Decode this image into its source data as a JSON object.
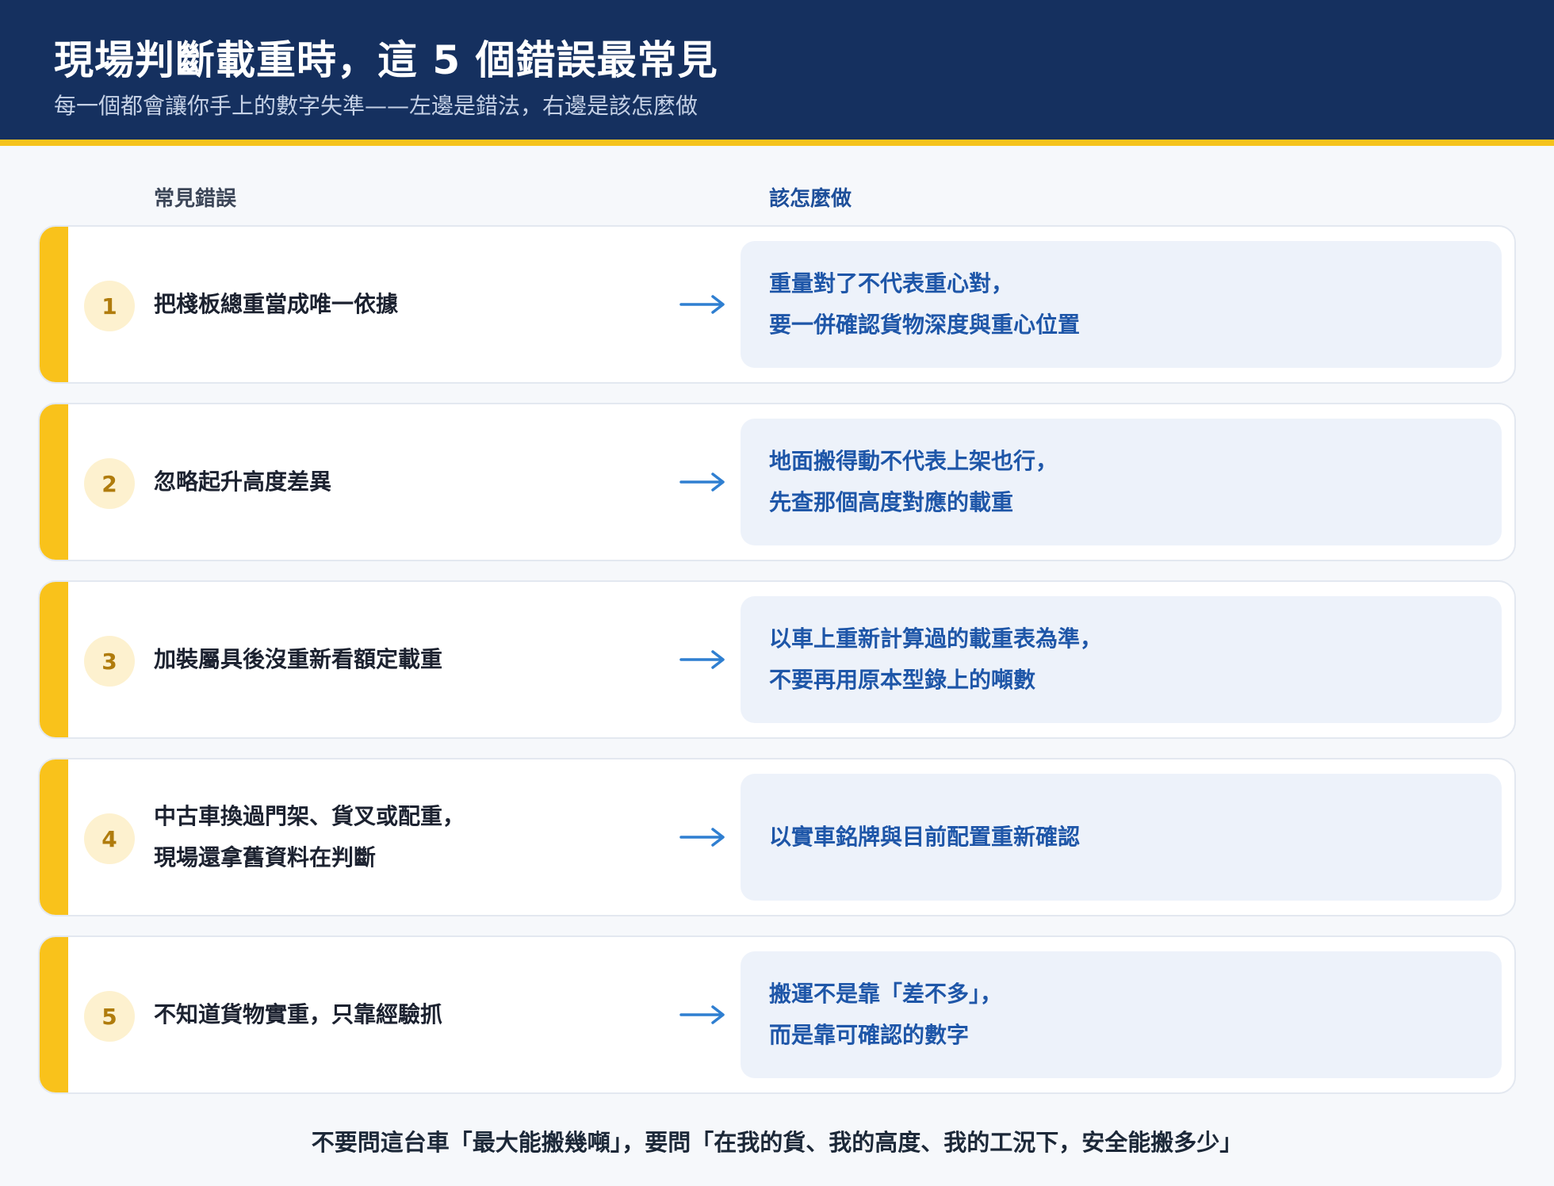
{
  "header": {
    "title": "現場判斷載重時，這 5 個錯誤最常見",
    "subtitle": "每一個都會讓你手上的數字失準——左邊是錯法，右邊是該怎麼做"
  },
  "columns": {
    "left": "常見錯誤",
    "right": "該怎麼做"
  },
  "rows": [
    {
      "number": "1",
      "mistake": [
        "把棧板總重當成唯一依據"
      ],
      "fix": [
        "重量對了不代表重心對，",
        "要一併確認貨物深度與重心位置"
      ]
    },
    {
      "number": "2",
      "mistake": [
        "忽略起升高度差異"
      ],
      "fix": [
        "地面搬得動不代表上架也行，",
        "先查那個高度對應的載重"
      ]
    },
    {
      "number": "3",
      "mistake": [
        "加裝屬具後沒重新看額定載重"
      ],
      "fix": [
        "以車上重新計算過的載重表為準，",
        "不要再用原本型錄上的噸數"
      ]
    },
    {
      "number": "4",
      "mistake": [
        "中古車換過門架、貨叉或配重，",
        "現場還拿舊資料在判斷"
      ],
      "fix": [
        "以實車銘牌與目前配置重新確認"
      ]
    },
    {
      "number": "5",
      "mistake": [
        "不知道貨物實重，只靠經驗抓"
      ],
      "fix": [
        "搬運不是靠「差不多」，",
        "而是靠可確認的數字"
      ]
    }
  ],
  "footer": "不要問這台車「最大能搬幾噸」，要問「在我的貨、我的高度、我的工況下，安全能搬多少」",
  "colors": {
    "header_bg": "#15305f",
    "accent": "#f9c21b",
    "fix_text": "#1e56a8",
    "fix_bg": "#edf2fa",
    "arrow": "#2f7fd1"
  },
  "icons": {
    "arrow": "arrow-right-icon"
  }
}
